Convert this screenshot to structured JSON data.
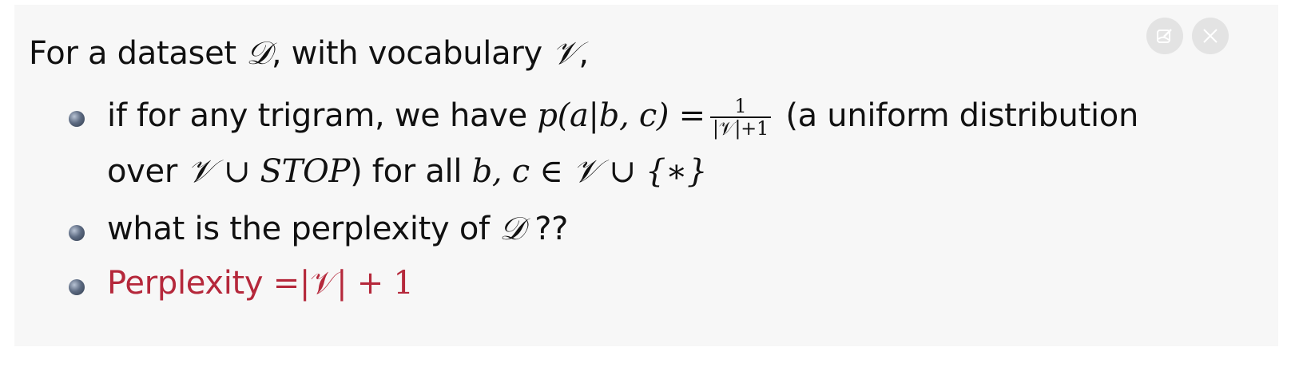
{
  "intro": {
    "text": "For a dataset ",
    "D": "𝒟",
    "mid": ", with vocabulary ",
    "V": "𝒱",
    "end": ","
  },
  "bullets": [
    {
      "t1": "if for any trigram, we have ",
      "math1": "p(a|b, c) =",
      "frac_num": "1",
      "frac_den": "|𝒱|+1",
      "t2": " (a uniform distribution",
      "t3": "over ",
      "math2": "𝒱 ∪ STOP",
      "t4": ") for all ",
      "math3": "b, c ∈ 𝒱 ∪ {∗}"
    },
    {
      "t1": "what is the perplexity of ",
      "math1": "𝒟",
      "t2": " ??"
    },
    {
      "t1": "Perplexity ",
      "math1": "=|𝒱| + 1"
    }
  ],
  "toolbar": {
    "edit_icon": "edit-image-icon",
    "close_icon": "close-icon"
  },
  "colors": {
    "answer": "#b5283b",
    "panel": "#f7f7f7"
  }
}
